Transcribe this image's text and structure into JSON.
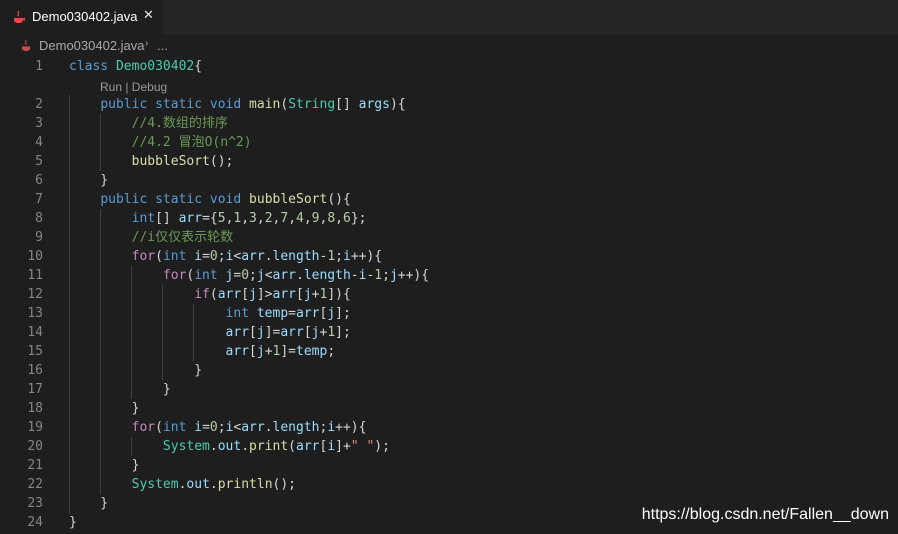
{
  "tab": {
    "title": "Demo030402.java",
    "close_glyph": "✕",
    "icon": "java-cup-icon"
  },
  "breadcrumb": {
    "file": "Demo030402.java",
    "separator": "›",
    "more": "..."
  },
  "codelens": "Run | Debug",
  "watermark": "https://blog.csdn.net/Fallen__down",
  "colors": {
    "editor_bg": "#1e1e1e",
    "tabbar_bg": "#252526",
    "line_number": "#858585",
    "keyword": "#569cd6",
    "control": "#c586c0",
    "function": "#dcdcaa",
    "type": "#4ec9b0",
    "number": "#b5cea8",
    "comment": "#6a9955",
    "string": "#ce9178"
  },
  "code_lines": [
    {
      "n": "1",
      "tokens": [
        [
          "kw",
          "class"
        ],
        [
          "pl",
          " "
        ],
        [
          "cls",
          "Demo030402"
        ],
        [
          "pl",
          "{"
        ]
      ]
    },
    {
      "n": "2",
      "tokens": [
        [
          "pl",
          "    "
        ],
        [
          "kw",
          "public"
        ],
        [
          "pl",
          " "
        ],
        [
          "kw",
          "static"
        ],
        [
          "pl",
          " "
        ],
        [
          "kw",
          "void"
        ],
        [
          "pl",
          " "
        ],
        [
          "fn",
          "main"
        ],
        [
          "pl",
          "("
        ],
        [
          "cls",
          "String"
        ],
        [
          "pl",
          "[] "
        ],
        [
          "var",
          "args"
        ],
        [
          "pl",
          "){"
        ]
      ]
    },
    {
      "n": "3",
      "tokens": [
        [
          "pl",
          "        "
        ],
        [
          "cm",
          "//4.数组的排序"
        ]
      ]
    },
    {
      "n": "4",
      "tokens": [
        [
          "pl",
          "        "
        ],
        [
          "cm",
          "//4.2 冒泡O(n^2)"
        ]
      ]
    },
    {
      "n": "5",
      "tokens": [
        [
          "pl",
          "        "
        ],
        [
          "fn",
          "bubbleSort"
        ],
        [
          "pl",
          "();"
        ]
      ]
    },
    {
      "n": "6",
      "tokens": [
        [
          "pl",
          "    }"
        ]
      ]
    },
    {
      "n": "7",
      "tokens": [
        [
          "pl",
          "    "
        ],
        [
          "kw",
          "public"
        ],
        [
          "pl",
          " "
        ],
        [
          "kw",
          "static"
        ],
        [
          "pl",
          " "
        ],
        [
          "kw",
          "void"
        ],
        [
          "pl",
          " "
        ],
        [
          "fn",
          "bubbleSort"
        ],
        [
          "pl",
          "(){"
        ]
      ]
    },
    {
      "n": "8",
      "tokens": [
        [
          "pl",
          "        "
        ],
        [
          "kw",
          "int"
        ],
        [
          "pl",
          "[] "
        ],
        [
          "var",
          "arr"
        ],
        [
          "pl",
          "={"
        ],
        [
          "num",
          "5"
        ],
        [
          "pl",
          ","
        ],
        [
          "num",
          "1"
        ],
        [
          "pl",
          ","
        ],
        [
          "num",
          "3"
        ],
        [
          "pl",
          ","
        ],
        [
          "num",
          "2"
        ],
        [
          "pl",
          ","
        ],
        [
          "num",
          "7"
        ],
        [
          "pl",
          ","
        ],
        [
          "num",
          "4"
        ],
        [
          "pl",
          ","
        ],
        [
          "num",
          "9"
        ],
        [
          "pl",
          ","
        ],
        [
          "num",
          "8"
        ],
        [
          "pl",
          ","
        ],
        [
          "num",
          "6"
        ],
        [
          "pl",
          "};"
        ]
      ]
    },
    {
      "n": "9",
      "tokens": [
        [
          "pl",
          "        "
        ],
        [
          "cm",
          "//i仅仅表示轮数"
        ]
      ]
    },
    {
      "n": "10",
      "tokens": [
        [
          "pl",
          "        "
        ],
        [
          "ctl",
          "for"
        ],
        [
          "pl",
          "("
        ],
        [
          "kw",
          "int"
        ],
        [
          "pl",
          " "
        ],
        [
          "var",
          "i"
        ],
        [
          "pl",
          "="
        ],
        [
          "num",
          "0"
        ],
        [
          "pl",
          ";"
        ],
        [
          "var",
          "i"
        ],
        [
          "pl",
          "<"
        ],
        [
          "var",
          "arr"
        ],
        [
          "pl",
          "."
        ],
        [
          "var",
          "length"
        ],
        [
          "pl",
          "-"
        ],
        [
          "num",
          "1"
        ],
        [
          "pl",
          ";"
        ],
        [
          "var",
          "i"
        ],
        [
          "pl",
          "++){"
        ]
      ]
    },
    {
      "n": "11",
      "tokens": [
        [
          "pl",
          "            "
        ],
        [
          "ctl",
          "for"
        ],
        [
          "pl",
          "("
        ],
        [
          "kw",
          "int"
        ],
        [
          "pl",
          " "
        ],
        [
          "var",
          "j"
        ],
        [
          "pl",
          "="
        ],
        [
          "num",
          "0"
        ],
        [
          "pl",
          ";"
        ],
        [
          "var",
          "j"
        ],
        [
          "pl",
          "<"
        ],
        [
          "var",
          "arr"
        ],
        [
          "pl",
          "."
        ],
        [
          "var",
          "length"
        ],
        [
          "pl",
          "-"
        ],
        [
          "var",
          "i"
        ],
        [
          "pl",
          "-"
        ],
        [
          "num",
          "1"
        ],
        [
          "pl",
          ";"
        ],
        [
          "var",
          "j"
        ],
        [
          "pl",
          "++){"
        ]
      ]
    },
    {
      "n": "12",
      "tokens": [
        [
          "pl",
          "                "
        ],
        [
          "ctl",
          "if"
        ],
        [
          "pl",
          "("
        ],
        [
          "var",
          "arr"
        ],
        [
          "pl",
          "["
        ],
        [
          "var",
          "j"
        ],
        [
          "pl",
          "]>"
        ],
        [
          "var",
          "arr"
        ],
        [
          "pl",
          "["
        ],
        [
          "var",
          "j"
        ],
        [
          "pl",
          "+"
        ],
        [
          "num",
          "1"
        ],
        [
          "pl",
          "]){"
        ]
      ]
    },
    {
      "n": "13",
      "tokens": [
        [
          "pl",
          "                    "
        ],
        [
          "kw",
          "int"
        ],
        [
          "pl",
          " "
        ],
        [
          "var",
          "temp"
        ],
        [
          "pl",
          "="
        ],
        [
          "var",
          "arr"
        ],
        [
          "pl",
          "["
        ],
        [
          "var",
          "j"
        ],
        [
          "pl",
          "];"
        ]
      ]
    },
    {
      "n": "14",
      "tokens": [
        [
          "pl",
          "                    "
        ],
        [
          "var",
          "arr"
        ],
        [
          "pl",
          "["
        ],
        [
          "var",
          "j"
        ],
        [
          "pl",
          "]="
        ],
        [
          "var",
          "arr"
        ],
        [
          "pl",
          "["
        ],
        [
          "var",
          "j"
        ],
        [
          "pl",
          "+"
        ],
        [
          "num",
          "1"
        ],
        [
          "pl",
          "];"
        ]
      ]
    },
    {
      "n": "15",
      "tokens": [
        [
          "pl",
          "                    "
        ],
        [
          "var",
          "arr"
        ],
        [
          "pl",
          "["
        ],
        [
          "var",
          "j"
        ],
        [
          "pl",
          "+"
        ],
        [
          "num",
          "1"
        ],
        [
          "pl",
          "]="
        ],
        [
          "var",
          "temp"
        ],
        [
          "pl",
          ";"
        ]
      ]
    },
    {
      "n": "16",
      "tokens": [
        [
          "pl",
          "                }"
        ]
      ]
    },
    {
      "n": "17",
      "tokens": [
        [
          "pl",
          "            }"
        ]
      ]
    },
    {
      "n": "18",
      "tokens": [
        [
          "pl",
          "        }"
        ]
      ]
    },
    {
      "n": "19",
      "tokens": [
        [
          "pl",
          "        "
        ],
        [
          "ctl",
          "for"
        ],
        [
          "pl",
          "("
        ],
        [
          "kw",
          "int"
        ],
        [
          "pl",
          " "
        ],
        [
          "var",
          "i"
        ],
        [
          "pl",
          "="
        ],
        [
          "num",
          "0"
        ],
        [
          "pl",
          ";"
        ],
        [
          "var",
          "i"
        ],
        [
          "pl",
          "<"
        ],
        [
          "var",
          "arr"
        ],
        [
          "pl",
          "."
        ],
        [
          "var",
          "length"
        ],
        [
          "pl",
          ";"
        ],
        [
          "var",
          "i"
        ],
        [
          "pl",
          "++){"
        ]
      ]
    },
    {
      "n": "20",
      "tokens": [
        [
          "pl",
          "            "
        ],
        [
          "cls",
          "System"
        ],
        [
          "pl",
          "."
        ],
        [
          "var",
          "out"
        ],
        [
          "pl",
          "."
        ],
        [
          "fn",
          "print"
        ],
        [
          "pl",
          "("
        ],
        [
          "var",
          "arr"
        ],
        [
          "pl",
          "["
        ],
        [
          "var",
          "i"
        ],
        [
          "pl",
          "]+"
        ],
        [
          "str",
          "\" \""
        ],
        [
          "pl",
          ");"
        ]
      ]
    },
    {
      "n": "21",
      "tokens": [
        [
          "pl",
          "        }"
        ]
      ]
    },
    {
      "n": "22",
      "tokens": [
        [
          "pl",
          "        "
        ],
        [
          "cls",
          "System"
        ],
        [
          "pl",
          "."
        ],
        [
          "var",
          "out"
        ],
        [
          "pl",
          "."
        ],
        [
          "fn",
          "println"
        ],
        [
          "pl",
          "();"
        ]
      ]
    },
    {
      "n": "23",
      "tokens": [
        [
          "pl",
          "    }"
        ]
      ]
    },
    {
      "n": "24",
      "tokens": [
        [
          "pl",
          "}"
        ]
      ]
    }
  ]
}
